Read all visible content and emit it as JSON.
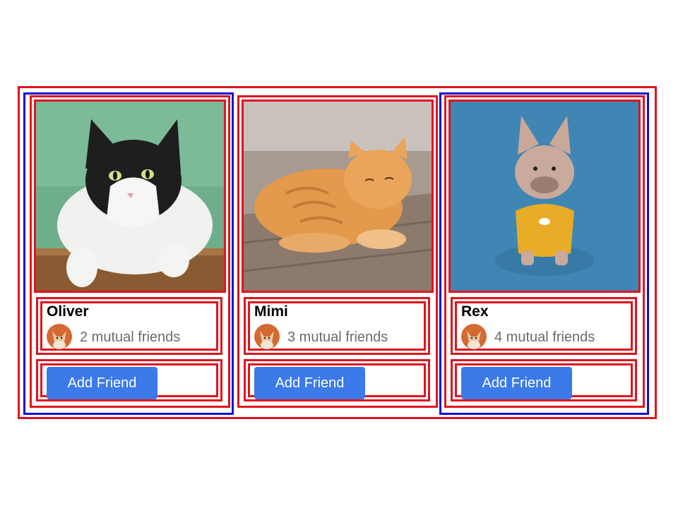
{
  "cards": [
    {
      "name": "Oliver",
      "mutual_friends": "2 mutual friends",
      "button_label": "Add Friend",
      "photo": "tuxedo-cat-photo"
    },
    {
      "name": "Mimi",
      "mutual_friends": "3 mutual friends",
      "button_label": "Add Friend",
      "photo": "orange-tabby-cat-photo"
    },
    {
      "name": "Rex",
      "mutual_friends": "4 mutual friends",
      "button_label": "Add Friend",
      "photo": "french-bulldog-photo"
    }
  ],
  "colors": {
    "outline_red": "#e0141e",
    "outline_blue": "#1010d8",
    "button_blue": "#3b7ae8",
    "muted_text": "#6b6b6b"
  }
}
